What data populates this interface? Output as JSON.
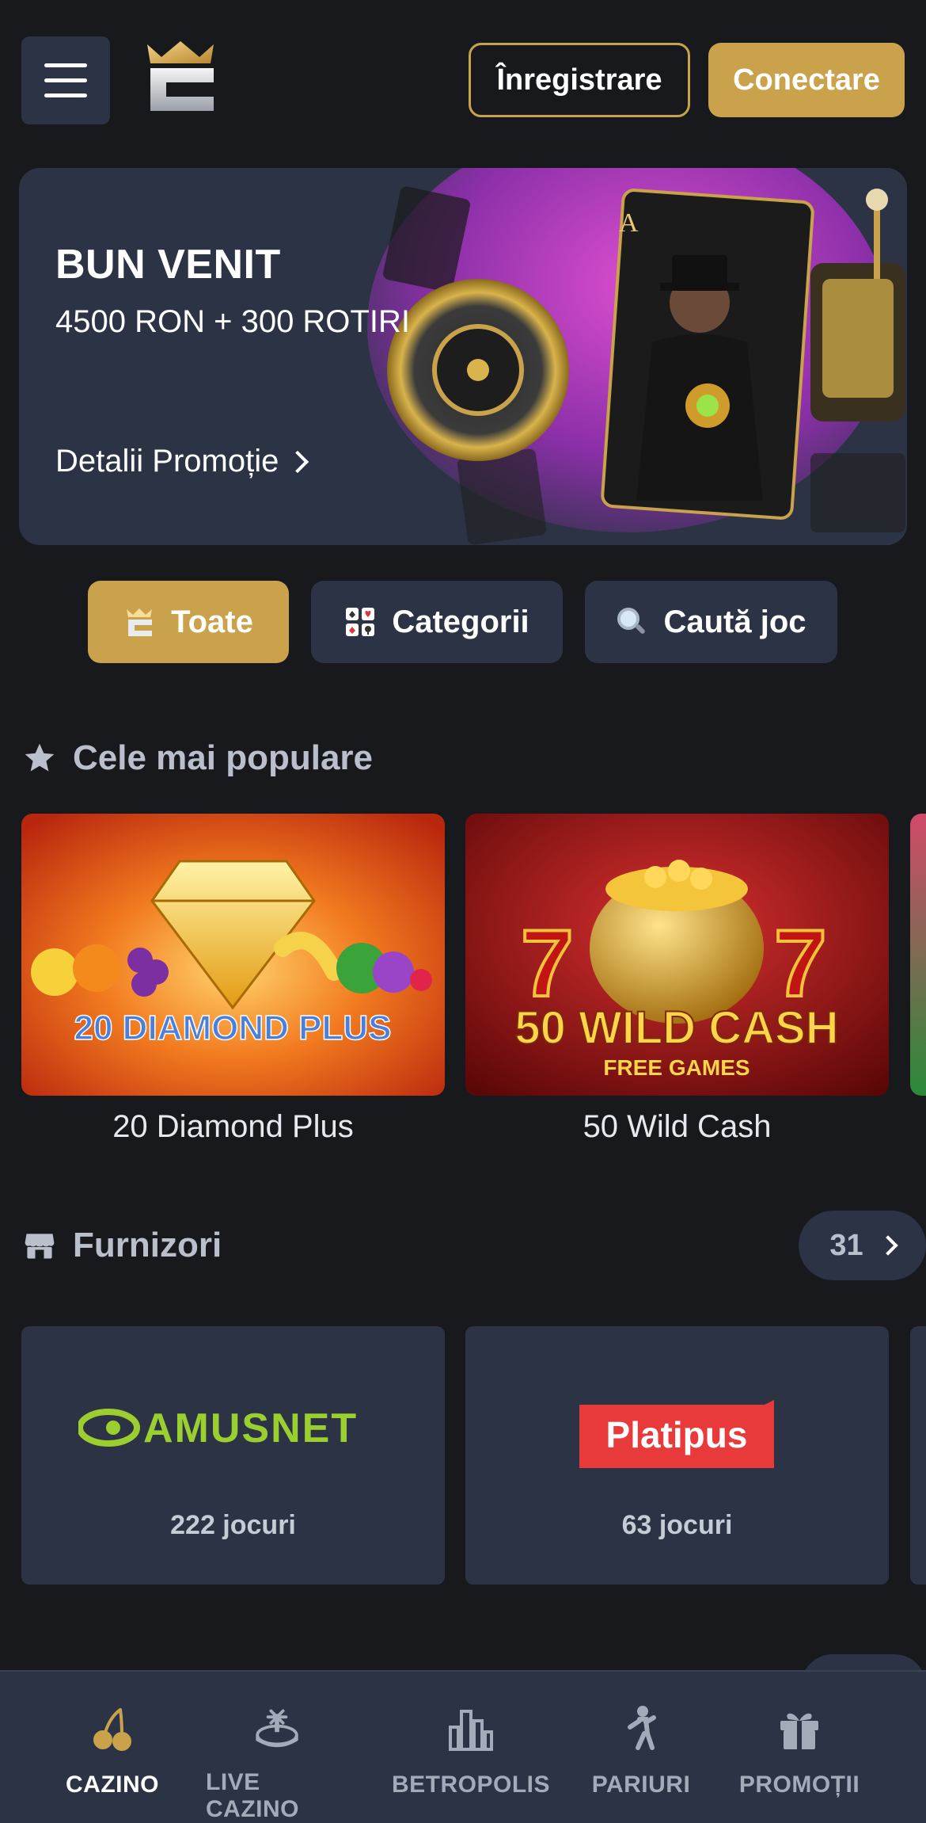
{
  "header": {
    "register_label": "Înregistrare",
    "login_label": "Conectare"
  },
  "banner": {
    "title": "BUN VENIT",
    "subtitle": "4500 RON + 300 ROTIRI",
    "link_label": "Detalii Promoție"
  },
  "filters": [
    {
      "label": "Toate",
      "icon": "crown-logo-icon"
    },
    {
      "label": "Categorii",
      "icon": "cards-icon"
    },
    {
      "label": "Caută joc",
      "icon": "magnifier-icon"
    }
  ],
  "popular": {
    "title": "Cele mai populare",
    "icon": "star-icon",
    "games": [
      {
        "name": "20 Diamond Plus",
        "art_text": "20 DIAMOND PLUS"
      },
      {
        "name": "50 Wild Cash",
        "art_text": "50 WILD CASH",
        "art_sub": "FREE GAMES"
      }
    ]
  },
  "providers": {
    "title": "Furnizori",
    "icon": "store-icon",
    "count": "31",
    "items": [
      {
        "logo_text": "AMUSNET",
        "count": "222 jocuri"
      },
      {
        "logo_text": "Platipus",
        "count": "63 jocuri"
      }
    ]
  },
  "bottom_nav": [
    {
      "label": "CAZINO",
      "icon": "cherries-icon",
      "active": true
    },
    {
      "label": "LIVE CAZINO",
      "icon": "roulette-icon",
      "active": false
    },
    {
      "label": "BETROPOLIS",
      "icon": "city-icon",
      "active": false
    },
    {
      "label": "PARIURI",
      "icon": "player-icon",
      "active": false
    },
    {
      "label": "PROMOȚII",
      "icon": "gift-icon",
      "active": false
    }
  ],
  "colors": {
    "background": "#17191d",
    "panel": "#2b3344",
    "accent_gold": "#c9a24b",
    "muted_text": "#b9c0cc"
  }
}
